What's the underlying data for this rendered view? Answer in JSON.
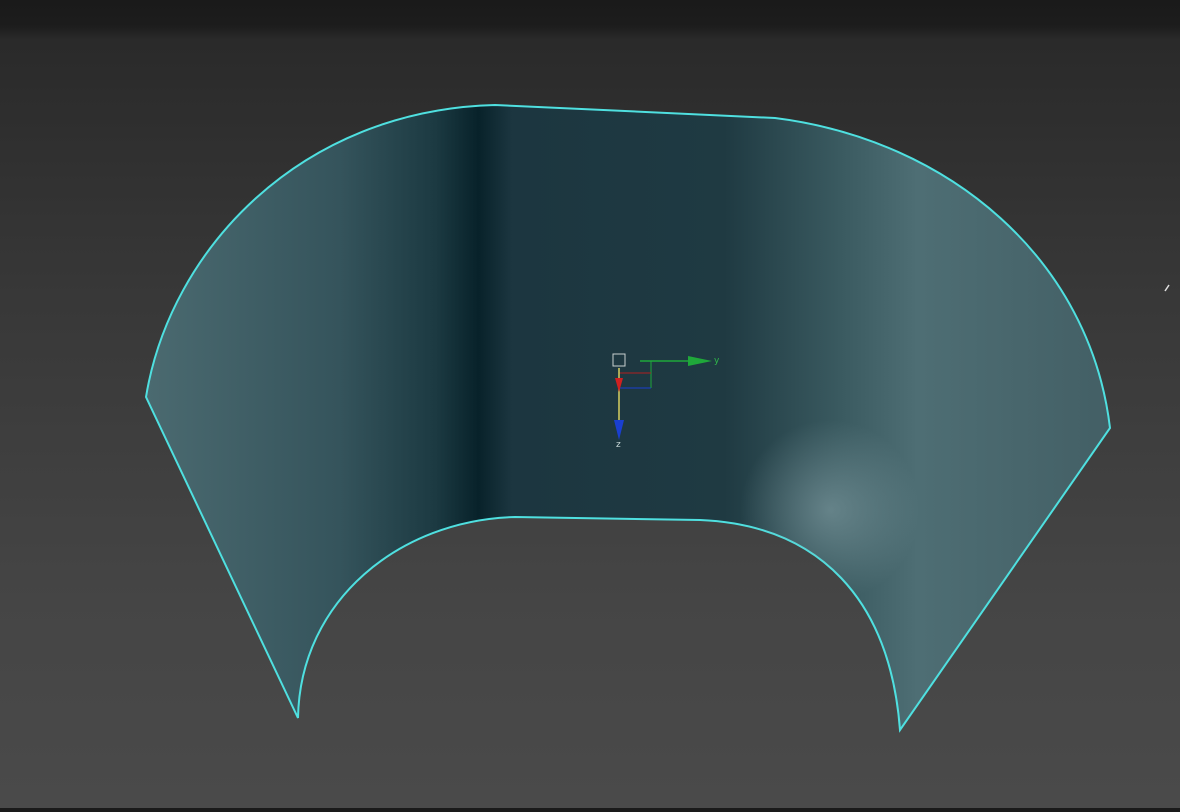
{
  "viewport": {
    "gizmo": {
      "y_label": "y",
      "z_label": "z"
    },
    "colors": {
      "edge": "#4fe0e0",
      "surface_dark": "#0e2a32",
      "surface_light": "#4a6a70",
      "axis_y": "#1fa83a",
      "axis_z": "#1a3fd0",
      "axis_x": "#d02020"
    }
  }
}
